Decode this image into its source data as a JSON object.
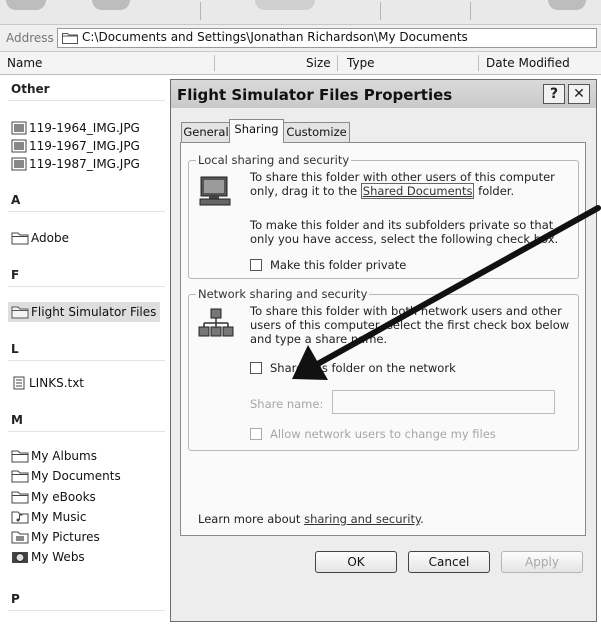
{
  "address": {
    "label": "Address",
    "path": "C:\\Documents and Settings\\Jonathan Richardson\\My Documents"
  },
  "columns": {
    "name": "Name",
    "size": "Size",
    "type": "Type",
    "date": "Date Modified"
  },
  "groups": {
    "other": "Other",
    "a": "A",
    "f": "F",
    "l": "L",
    "m": "M",
    "p": "P"
  },
  "files": {
    "other": [
      "119-1964_IMG.JPG",
      "119-1967_IMG.JPG",
      "119-1987_IMG.JPG"
    ],
    "a": [
      "Adobe"
    ],
    "f": [
      "Flight Simulator Files"
    ],
    "l": [
      "LINKS.txt"
    ],
    "m": [
      "My Albums",
      "My Documents",
      "My eBooks",
      "My Music",
      "My Pictures",
      "My Webs"
    ]
  },
  "dialog": {
    "title": "Flight Simulator Files Properties",
    "help_glyph": "?",
    "close_glyph": "✕",
    "tabs": [
      "General",
      "Sharing",
      "Customize"
    ],
    "local": {
      "legend": "Local sharing and security",
      "line1": "To share this folder with other users of this computer",
      "line2_pre": "only, drag it to the ",
      "line2_link": "Shared Documents",
      "line2_post": " folder.",
      "private_line1": "To make this folder and its subfolders private so that",
      "private_line2": "only you have access, select the following check box.",
      "private_checkbox": "Make this folder private"
    },
    "network": {
      "legend": "Network sharing and security",
      "line1": "To share this folder with both network users and other",
      "line2": "users of this computer, select the first check box below",
      "line3": "and type a share name.",
      "share_checkbox": "Share this folder on the network",
      "share_name_label": "Share name:",
      "share_name_value": "",
      "allow_checkbox": "Allow network users to change my files"
    },
    "learn_pre": "Learn more about ",
    "learn_link": "sharing and security",
    "learn_post": ".",
    "buttons": {
      "ok": "OK",
      "cancel": "Cancel",
      "apply": "Apply"
    }
  },
  "colors": {
    "arrow": "#111111",
    "dialog_bg": "#ededed",
    "panel_bg": "#fafafa"
  }
}
